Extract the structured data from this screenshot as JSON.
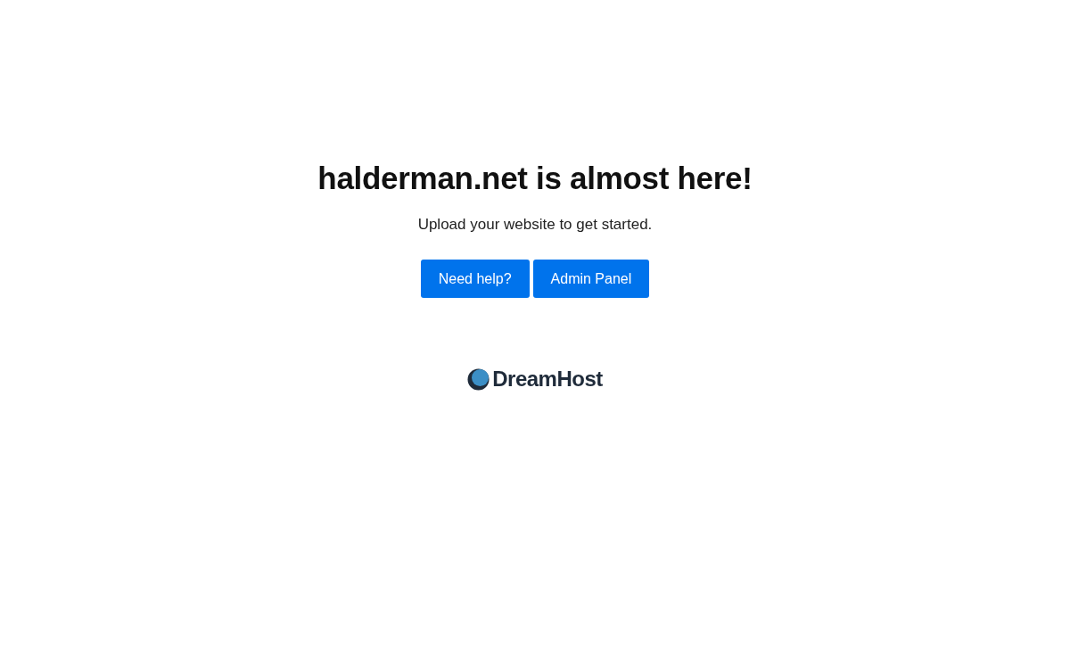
{
  "heading": "halderman.net is almost here!",
  "subtitle": "Upload your website to get started.",
  "buttons": [
    {
      "label": "Need help?"
    },
    {
      "label": "Admin Panel"
    }
  ],
  "logo": {
    "text": "DreamHost"
  }
}
